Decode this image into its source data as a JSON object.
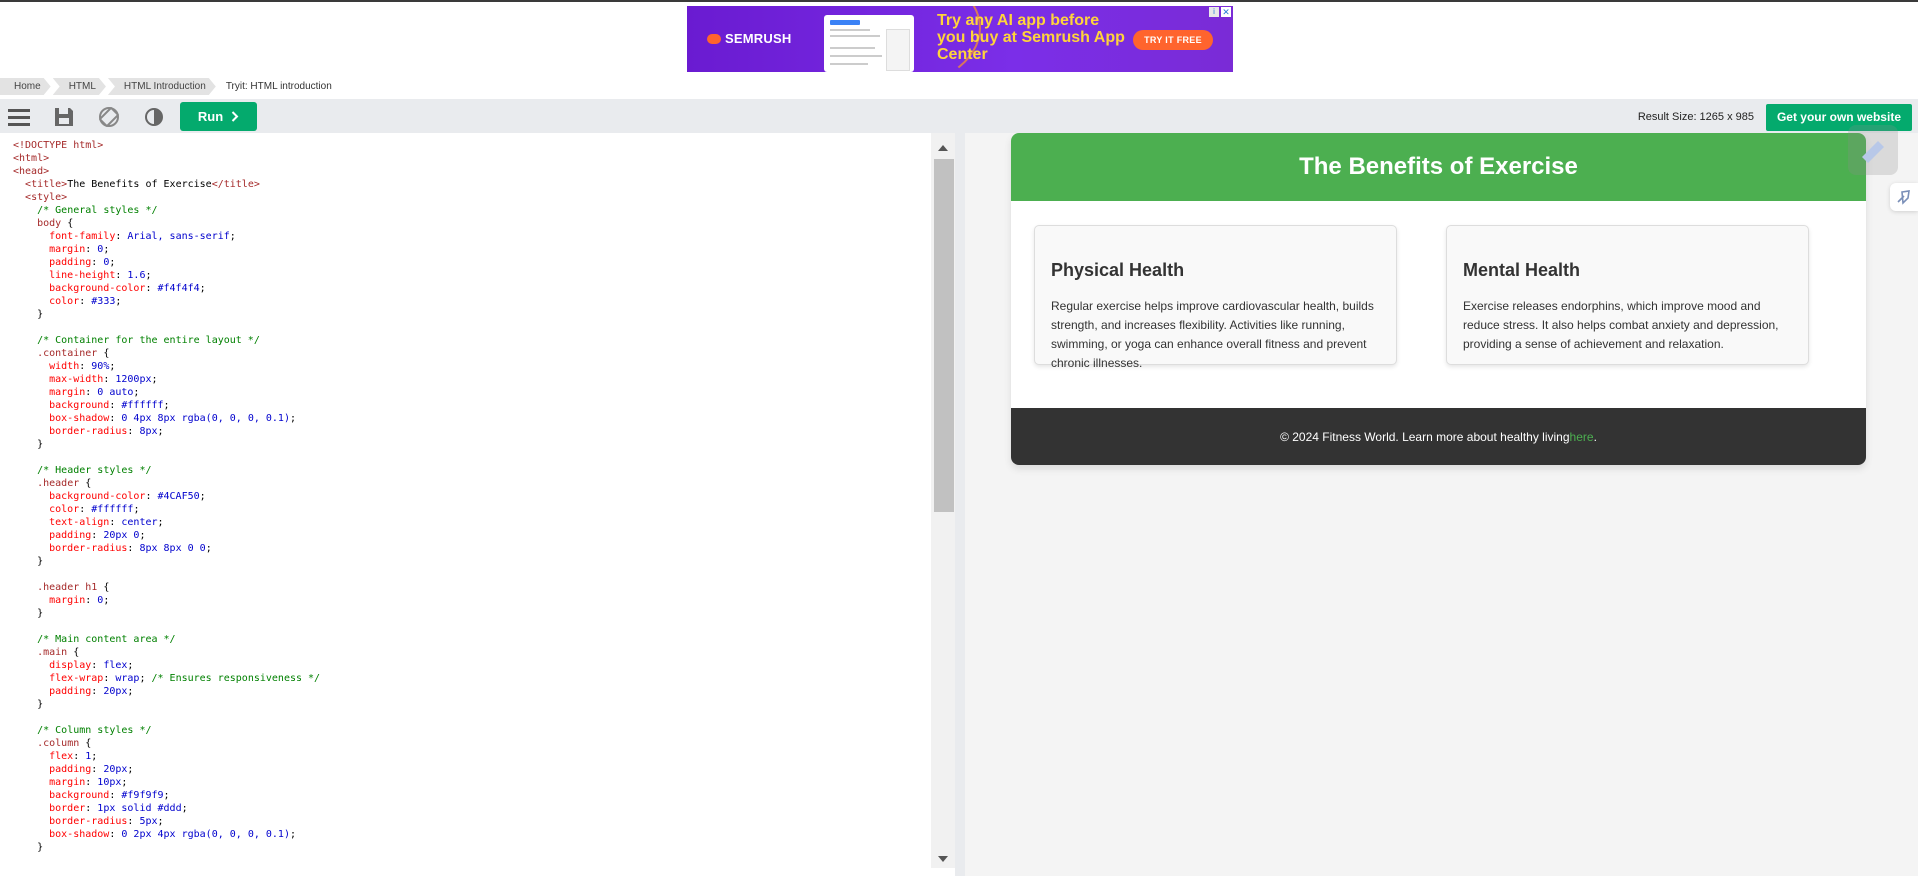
{
  "ad": {
    "logo": "SEMRUSH",
    "headline": "Try any AI app before you buy at Semrush App Center",
    "cta": "TRY IT FREE",
    "info": "i",
    "close": "✕"
  },
  "breadcrumb": {
    "items": [
      "Home",
      "HTML",
      "HTML Introduction"
    ],
    "current": "Tryit: HTML introduction"
  },
  "toolbar": {
    "run_label": "Run",
    "result_size": "Result Size: 1265 x 985",
    "own_website": "Get your own website",
    "icons": [
      "menu-icon",
      "save-icon",
      "rotate-icon",
      "contrast-icon"
    ]
  },
  "editor": {
    "lines": [
      [
        [
          "t",
          "<!DOCTYPE html>"
        ]
      ],
      [
        [
          "t",
          "<html>"
        ]
      ],
      [
        [
          "t",
          "<head>"
        ]
      ],
      [
        [
          "p",
          "  "
        ],
        [
          "t",
          "<title>"
        ],
        [
          "p",
          "The Benefits of Exercise"
        ],
        [
          "t",
          "</title>"
        ]
      ],
      [
        [
          "p",
          "  "
        ],
        [
          "t",
          "<style>"
        ]
      ],
      [
        [
          "p",
          "    "
        ],
        [
          "c",
          "/* General styles */"
        ]
      ],
      [
        [
          "p",
          "    "
        ],
        [
          "s",
          "body"
        ],
        [
          "p",
          " {"
        ]
      ],
      [
        [
          "p",
          "      "
        ],
        [
          "k",
          "font-family"
        ],
        [
          "p",
          ": "
        ],
        [
          "v",
          "Arial, sans-serif"
        ],
        [
          "p",
          ";"
        ]
      ],
      [
        [
          "p",
          "      "
        ],
        [
          "k",
          "margin"
        ],
        [
          "p",
          ": "
        ],
        [
          "v",
          "0"
        ],
        [
          "p",
          ";"
        ]
      ],
      [
        [
          "p",
          "      "
        ],
        [
          "k",
          "padding"
        ],
        [
          "p",
          ": "
        ],
        [
          "v",
          "0"
        ],
        [
          "p",
          ";"
        ]
      ],
      [
        [
          "p",
          "      "
        ],
        [
          "k",
          "line-height"
        ],
        [
          "p",
          ": "
        ],
        [
          "v",
          "1.6"
        ],
        [
          "p",
          ";"
        ]
      ],
      [
        [
          "p",
          "      "
        ],
        [
          "k",
          "background-color"
        ],
        [
          "p",
          ": "
        ],
        [
          "v",
          "#f4f4f4"
        ],
        [
          "p",
          ";"
        ]
      ],
      [
        [
          "p",
          "      "
        ],
        [
          "k",
          "color"
        ],
        [
          "p",
          ": "
        ],
        [
          "v",
          "#333"
        ],
        [
          "p",
          ";"
        ]
      ],
      [
        [
          "p",
          "    }"
        ]
      ],
      [
        [
          "p",
          ""
        ]
      ],
      [
        [
          "p",
          "    "
        ],
        [
          "c",
          "/* Container for the entire layout */"
        ]
      ],
      [
        [
          "p",
          "    "
        ],
        [
          "s",
          ".container"
        ],
        [
          "p",
          " {"
        ]
      ],
      [
        [
          "p",
          "      "
        ],
        [
          "k",
          "width"
        ],
        [
          "p",
          ": "
        ],
        [
          "v",
          "90%"
        ],
        [
          "p",
          ";"
        ]
      ],
      [
        [
          "p",
          "      "
        ],
        [
          "k",
          "max-width"
        ],
        [
          "p",
          ": "
        ],
        [
          "v",
          "1200px"
        ],
        [
          "p",
          ";"
        ]
      ],
      [
        [
          "p",
          "      "
        ],
        [
          "k",
          "margin"
        ],
        [
          "p",
          ": "
        ],
        [
          "v",
          "0 auto"
        ],
        [
          "p",
          ";"
        ]
      ],
      [
        [
          "p",
          "      "
        ],
        [
          "k",
          "background"
        ],
        [
          "p",
          ": "
        ],
        [
          "v",
          "#ffffff"
        ],
        [
          "p",
          ";"
        ]
      ],
      [
        [
          "p",
          "      "
        ],
        [
          "k",
          "box-shadow"
        ],
        [
          "p",
          ": "
        ],
        [
          "v",
          "0 4px 8px rgba(0, 0, 0, 0.1)"
        ],
        [
          "p",
          ";"
        ]
      ],
      [
        [
          "p",
          "      "
        ],
        [
          "k",
          "border-radius"
        ],
        [
          "p",
          ": "
        ],
        [
          "v",
          "8px"
        ],
        [
          "p",
          ";"
        ]
      ],
      [
        [
          "p",
          "    }"
        ]
      ],
      [
        [
          "p",
          ""
        ]
      ],
      [
        [
          "p",
          "    "
        ],
        [
          "c",
          "/* Header styles */"
        ]
      ],
      [
        [
          "p",
          "    "
        ],
        [
          "s",
          ".header"
        ],
        [
          "p",
          " {"
        ]
      ],
      [
        [
          "p",
          "      "
        ],
        [
          "k",
          "background-color"
        ],
        [
          "p",
          ": "
        ],
        [
          "v",
          "#4CAF50"
        ],
        [
          "p",
          ";"
        ]
      ],
      [
        [
          "p",
          "      "
        ],
        [
          "k",
          "color"
        ],
        [
          "p",
          ": "
        ],
        [
          "v",
          "#ffffff"
        ],
        [
          "p",
          ";"
        ]
      ],
      [
        [
          "p",
          "      "
        ],
        [
          "k",
          "text-align"
        ],
        [
          "p",
          ": "
        ],
        [
          "v",
          "center"
        ],
        [
          "p",
          ";"
        ]
      ],
      [
        [
          "p",
          "      "
        ],
        [
          "k",
          "padding"
        ],
        [
          "p",
          ": "
        ],
        [
          "v",
          "20px 0"
        ],
        [
          "p",
          ";"
        ]
      ],
      [
        [
          "p",
          "      "
        ],
        [
          "k",
          "border-radius"
        ],
        [
          "p",
          ": "
        ],
        [
          "v",
          "8px 8px 0 0"
        ],
        [
          "p",
          ";"
        ]
      ],
      [
        [
          "p",
          "    }"
        ]
      ],
      [
        [
          "p",
          ""
        ]
      ],
      [
        [
          "p",
          "    "
        ],
        [
          "s",
          ".header h1"
        ],
        [
          "p",
          " {"
        ]
      ],
      [
        [
          "p",
          "      "
        ],
        [
          "k",
          "margin"
        ],
        [
          "p",
          ": "
        ],
        [
          "v",
          "0"
        ],
        [
          "p",
          ";"
        ]
      ],
      [
        [
          "p",
          "    }"
        ]
      ],
      [
        [
          "p",
          ""
        ]
      ],
      [
        [
          "p",
          "    "
        ],
        [
          "c",
          "/* Main content area */"
        ]
      ],
      [
        [
          "p",
          "    "
        ],
        [
          "s",
          ".main"
        ],
        [
          "p",
          " {"
        ]
      ],
      [
        [
          "p",
          "      "
        ],
        [
          "k",
          "display"
        ],
        [
          "p",
          ": "
        ],
        [
          "v",
          "flex"
        ],
        [
          "p",
          ";"
        ]
      ],
      [
        [
          "p",
          "      "
        ],
        [
          "k",
          "flex-wrap"
        ],
        [
          "p",
          ": "
        ],
        [
          "v",
          "wrap"
        ],
        [
          "p",
          "; "
        ],
        [
          "c",
          "/* Ensures responsiveness */"
        ]
      ],
      [
        [
          "p",
          "      "
        ],
        [
          "k",
          "padding"
        ],
        [
          "p",
          ": "
        ],
        [
          "v",
          "20px"
        ],
        [
          "p",
          ";"
        ]
      ],
      [
        [
          "p",
          "    }"
        ]
      ],
      [
        [
          "p",
          ""
        ]
      ],
      [
        [
          "p",
          "    "
        ],
        [
          "c",
          "/* Column styles */"
        ]
      ],
      [
        [
          "p",
          "    "
        ],
        [
          "s",
          ".column"
        ],
        [
          "p",
          " {"
        ]
      ],
      [
        [
          "p",
          "      "
        ],
        [
          "k",
          "flex"
        ],
        [
          "p",
          ": "
        ],
        [
          "v",
          "1"
        ],
        [
          "p",
          ";"
        ]
      ],
      [
        [
          "p",
          "      "
        ],
        [
          "k",
          "padding"
        ],
        [
          "p",
          ": "
        ],
        [
          "v",
          "20px"
        ],
        [
          "p",
          ";"
        ]
      ],
      [
        [
          "p",
          "      "
        ],
        [
          "k",
          "margin"
        ],
        [
          "p",
          ": "
        ],
        [
          "v",
          "10px"
        ],
        [
          "p",
          ";"
        ]
      ],
      [
        [
          "p",
          "      "
        ],
        [
          "k",
          "background"
        ],
        [
          "p",
          ": "
        ],
        [
          "v",
          "#f9f9f9"
        ],
        [
          "p",
          ";"
        ]
      ],
      [
        [
          "p",
          "      "
        ],
        [
          "k",
          "border"
        ],
        [
          "p",
          ": "
        ],
        [
          "v",
          "1px solid #ddd"
        ],
        [
          "p",
          ";"
        ]
      ],
      [
        [
          "p",
          "      "
        ],
        [
          "k",
          "border-radius"
        ],
        [
          "p",
          ": "
        ],
        [
          "v",
          "5px"
        ],
        [
          "p",
          ";"
        ]
      ],
      [
        [
          "p",
          "      "
        ],
        [
          "k",
          "box-shadow"
        ],
        [
          "p",
          ": "
        ],
        [
          "v",
          "0 2px 4px rgba(0, 0, 0, 0.1)"
        ],
        [
          "p",
          ";"
        ]
      ],
      [
        [
          "p",
          "    }"
        ]
      ]
    ]
  },
  "result": {
    "header_title": "The Benefits of Exercise",
    "columns": [
      {
        "title": "Physical Health",
        "text": "Regular exercise helps improve cardiovascular health, builds strength, and increases flexibility. Activities like running, swimming, or yoga can enhance overall fitness and prevent chronic illnesses."
      },
      {
        "title": "Mental Health",
        "text": "Exercise releases endorphins, which improve mood and reduce stress. It also helps combat anxiety and depression, providing a sense of achievement and relaxation."
      }
    ],
    "footer_text": "© 2024 Fitness World. Learn more about healthy living ",
    "footer_link": "here",
    "footer_end": "."
  },
  "colors": {
    "run_green": "#04aa6d",
    "header_green": "#4caf50",
    "footer_dark": "#333333",
    "ad_purple": "#7b2ee8",
    "ad_cta": "#ff642d"
  }
}
